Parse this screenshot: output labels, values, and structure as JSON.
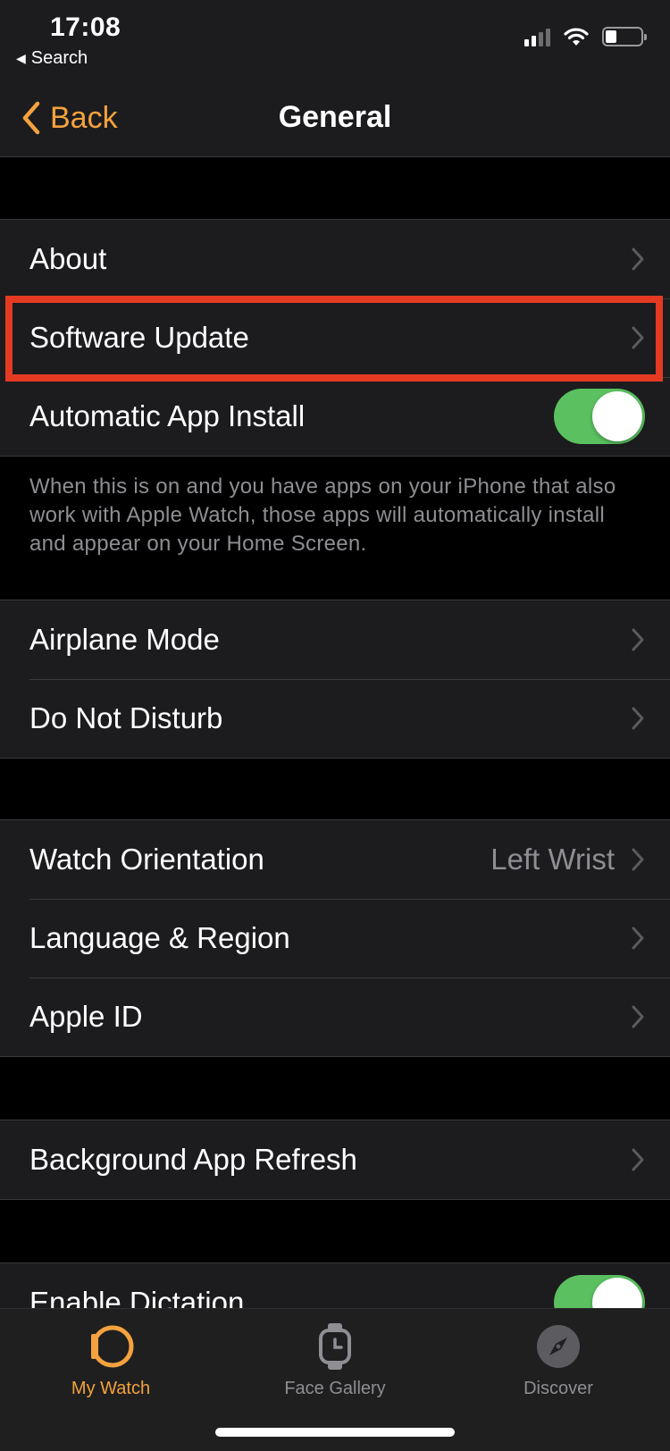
{
  "status_bar": {
    "time": "17:08",
    "back_app": "Search"
  },
  "nav": {
    "back_label": "Back",
    "title": "General"
  },
  "sections": {
    "about": {
      "label": "About"
    },
    "software_update": {
      "label": "Software Update"
    },
    "auto_install": {
      "label": "Automatic App Install",
      "enabled": true,
      "footer": "When this is on and you have apps on your iPhone that also work with Apple Watch, those apps will automatically install and appear on your Home Screen."
    },
    "airplane_mode": {
      "label": "Airplane Mode"
    },
    "do_not_disturb": {
      "label": "Do Not Disturb"
    },
    "watch_orientation": {
      "label": "Watch Orientation",
      "value": "Left Wrist"
    },
    "language_region": {
      "label": "Language & Region"
    },
    "apple_id": {
      "label": "Apple ID"
    },
    "background_refresh": {
      "label": "Background App Refresh"
    },
    "dictation": {
      "label": "Enable Dictation",
      "enabled": true
    }
  },
  "tab_bar": {
    "my_watch": "My Watch",
    "face_gallery": "Face Gallery",
    "discover": "Discover",
    "active_color": "#f4a23e",
    "inactive_color": "#8e8e93"
  },
  "colors": {
    "accent": "#f4a23e",
    "toggle_on": "#5ac060",
    "highlight": "#e43a22"
  }
}
